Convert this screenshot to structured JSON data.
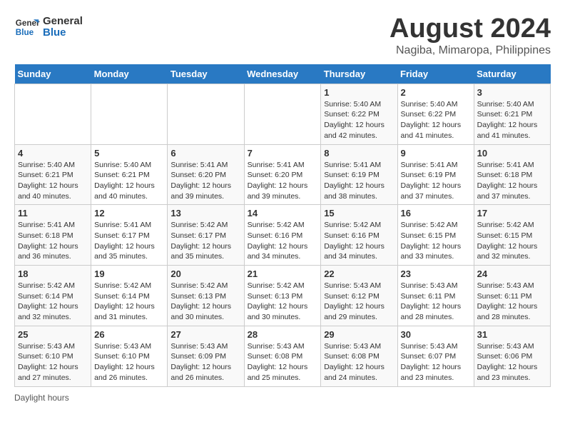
{
  "logo": {
    "line1": "General",
    "line2": "Blue"
  },
  "title": "August 2024",
  "subtitle": "Nagiba, Mimaropa, Philippines",
  "days_of_week": [
    "Sunday",
    "Monday",
    "Tuesday",
    "Wednesday",
    "Thursday",
    "Friday",
    "Saturday"
  ],
  "weeks": [
    [
      {
        "day": "",
        "info": ""
      },
      {
        "day": "",
        "info": ""
      },
      {
        "day": "",
        "info": ""
      },
      {
        "day": "",
        "info": ""
      },
      {
        "day": "1",
        "info": "Sunrise: 5:40 AM\nSunset: 6:22 PM\nDaylight: 12 hours and 42 minutes."
      },
      {
        "day": "2",
        "info": "Sunrise: 5:40 AM\nSunset: 6:22 PM\nDaylight: 12 hours and 41 minutes."
      },
      {
        "day": "3",
        "info": "Sunrise: 5:40 AM\nSunset: 6:21 PM\nDaylight: 12 hours and 41 minutes."
      }
    ],
    [
      {
        "day": "4",
        "info": "Sunrise: 5:40 AM\nSunset: 6:21 PM\nDaylight: 12 hours and 40 minutes."
      },
      {
        "day": "5",
        "info": "Sunrise: 5:40 AM\nSunset: 6:21 PM\nDaylight: 12 hours and 40 minutes."
      },
      {
        "day": "6",
        "info": "Sunrise: 5:41 AM\nSunset: 6:20 PM\nDaylight: 12 hours and 39 minutes."
      },
      {
        "day": "7",
        "info": "Sunrise: 5:41 AM\nSunset: 6:20 PM\nDaylight: 12 hours and 39 minutes."
      },
      {
        "day": "8",
        "info": "Sunrise: 5:41 AM\nSunset: 6:19 PM\nDaylight: 12 hours and 38 minutes."
      },
      {
        "day": "9",
        "info": "Sunrise: 5:41 AM\nSunset: 6:19 PM\nDaylight: 12 hours and 37 minutes."
      },
      {
        "day": "10",
        "info": "Sunrise: 5:41 AM\nSunset: 6:18 PM\nDaylight: 12 hours and 37 minutes."
      }
    ],
    [
      {
        "day": "11",
        "info": "Sunrise: 5:41 AM\nSunset: 6:18 PM\nDaylight: 12 hours and 36 minutes."
      },
      {
        "day": "12",
        "info": "Sunrise: 5:41 AM\nSunset: 6:17 PM\nDaylight: 12 hours and 35 minutes."
      },
      {
        "day": "13",
        "info": "Sunrise: 5:42 AM\nSunset: 6:17 PM\nDaylight: 12 hours and 35 minutes."
      },
      {
        "day": "14",
        "info": "Sunrise: 5:42 AM\nSunset: 6:16 PM\nDaylight: 12 hours and 34 minutes."
      },
      {
        "day": "15",
        "info": "Sunrise: 5:42 AM\nSunset: 6:16 PM\nDaylight: 12 hours and 34 minutes."
      },
      {
        "day": "16",
        "info": "Sunrise: 5:42 AM\nSunset: 6:15 PM\nDaylight: 12 hours and 33 minutes."
      },
      {
        "day": "17",
        "info": "Sunrise: 5:42 AM\nSunset: 6:15 PM\nDaylight: 12 hours and 32 minutes."
      }
    ],
    [
      {
        "day": "18",
        "info": "Sunrise: 5:42 AM\nSunset: 6:14 PM\nDaylight: 12 hours and 32 minutes."
      },
      {
        "day": "19",
        "info": "Sunrise: 5:42 AM\nSunset: 6:14 PM\nDaylight: 12 hours and 31 minutes."
      },
      {
        "day": "20",
        "info": "Sunrise: 5:42 AM\nSunset: 6:13 PM\nDaylight: 12 hours and 30 minutes."
      },
      {
        "day": "21",
        "info": "Sunrise: 5:42 AM\nSunset: 6:13 PM\nDaylight: 12 hours and 30 minutes."
      },
      {
        "day": "22",
        "info": "Sunrise: 5:43 AM\nSunset: 6:12 PM\nDaylight: 12 hours and 29 minutes."
      },
      {
        "day": "23",
        "info": "Sunrise: 5:43 AM\nSunset: 6:11 PM\nDaylight: 12 hours and 28 minutes."
      },
      {
        "day": "24",
        "info": "Sunrise: 5:43 AM\nSunset: 6:11 PM\nDaylight: 12 hours and 28 minutes."
      }
    ],
    [
      {
        "day": "25",
        "info": "Sunrise: 5:43 AM\nSunset: 6:10 PM\nDaylight: 12 hours and 27 minutes."
      },
      {
        "day": "26",
        "info": "Sunrise: 5:43 AM\nSunset: 6:10 PM\nDaylight: 12 hours and 26 minutes."
      },
      {
        "day": "27",
        "info": "Sunrise: 5:43 AM\nSunset: 6:09 PM\nDaylight: 12 hours and 26 minutes."
      },
      {
        "day": "28",
        "info": "Sunrise: 5:43 AM\nSunset: 6:08 PM\nDaylight: 12 hours and 25 minutes."
      },
      {
        "day": "29",
        "info": "Sunrise: 5:43 AM\nSunset: 6:08 PM\nDaylight: 12 hours and 24 minutes."
      },
      {
        "day": "30",
        "info": "Sunrise: 5:43 AM\nSunset: 6:07 PM\nDaylight: 12 hours and 23 minutes."
      },
      {
        "day": "31",
        "info": "Sunrise: 5:43 AM\nSunset: 6:06 PM\nDaylight: 12 hours and 23 minutes."
      }
    ]
  ],
  "footer": "Daylight hours"
}
